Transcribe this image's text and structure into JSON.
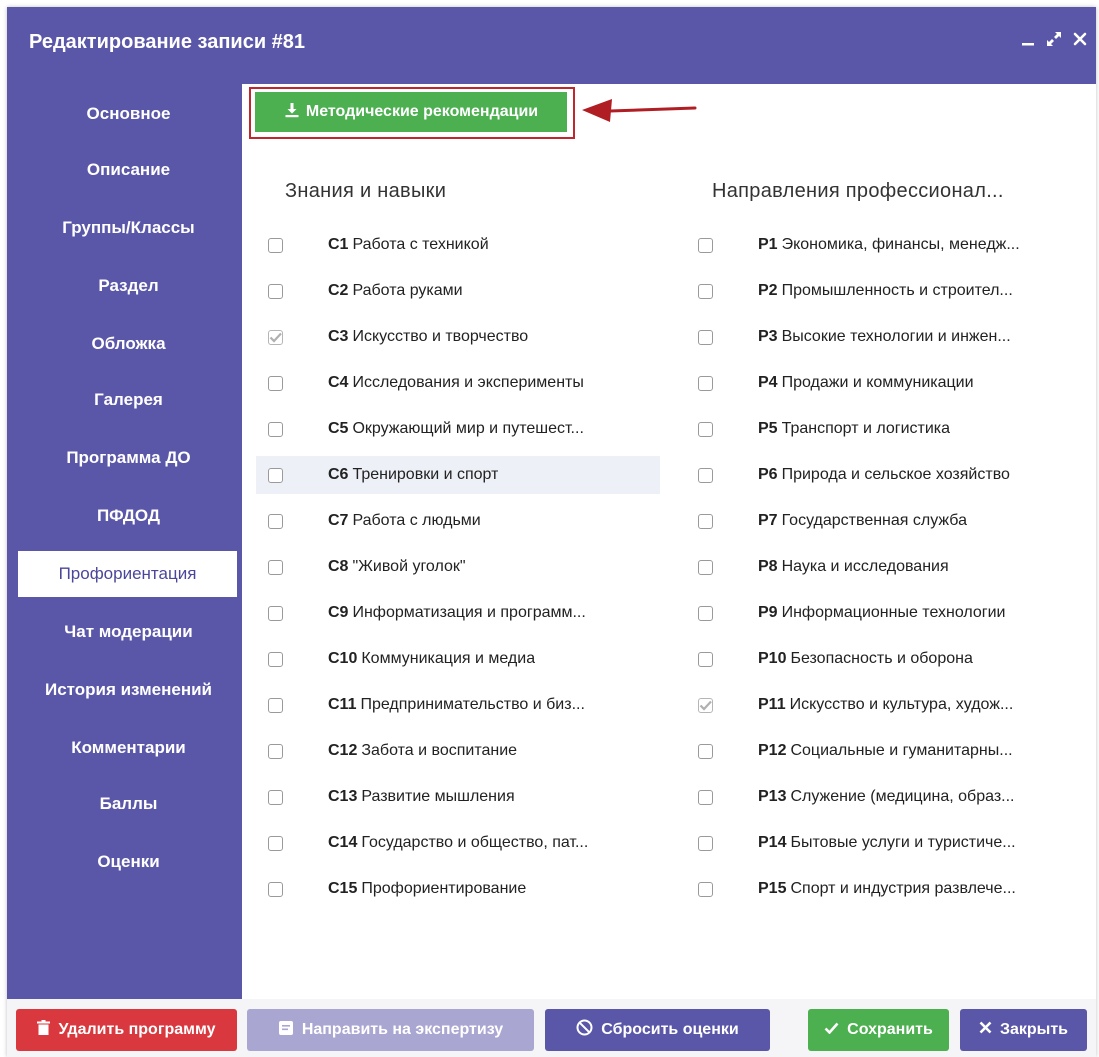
{
  "window": {
    "title": "Редактирование записи #81"
  },
  "sidebar": {
    "items": [
      {
        "label": "Основное"
      },
      {
        "label": "Описание"
      },
      {
        "label": "Группы/Классы"
      },
      {
        "label": "Раздел"
      },
      {
        "label": "Обложка"
      },
      {
        "label": "Галерея"
      },
      {
        "label": "Программа ДО"
      },
      {
        "label": "ПФДОД"
      },
      {
        "label": "Профориентация",
        "active": true
      },
      {
        "label": "Чат модерации"
      },
      {
        "label": "История изменений"
      },
      {
        "label": "Комментарии"
      },
      {
        "label": "Баллы"
      },
      {
        "label": "Оценки"
      }
    ]
  },
  "main": {
    "method_button": "Методические рекомендации",
    "skills": {
      "title": "Знания и навыки",
      "items": [
        {
          "code": "C1",
          "label": "Работа с техникой",
          "checked": false
        },
        {
          "code": "C2",
          "label": "Работа руками",
          "checked": false
        },
        {
          "code": "C3",
          "label": "Искусство и творчество",
          "checked": true
        },
        {
          "code": "C4",
          "label": "Исследования и эксперименты",
          "checked": false
        },
        {
          "code": "C5",
          "label": "Окружающий мир и путешест...",
          "checked": false
        },
        {
          "code": "C6",
          "label": "Тренировки и спорт",
          "checked": false
        },
        {
          "code": "C7",
          "label": "Работа с людьми",
          "checked": false
        },
        {
          "code": "C8",
          "label": "\"Живой уголок\"",
          "checked": false
        },
        {
          "code": "C9",
          "label": "Информатизация и программ...",
          "checked": false
        },
        {
          "code": "C10",
          "label": "Коммуникация и медиа",
          "checked": false
        },
        {
          "code": "C11",
          "label": "Предпринимательство и биз...",
          "checked": false
        },
        {
          "code": "C12",
          "label": "Забота и воспитание",
          "checked": false
        },
        {
          "code": "C13",
          "label": "Развитие мышления",
          "checked": false
        },
        {
          "code": "C14",
          "label": "Государство и общество, пат...",
          "checked": false
        },
        {
          "code": "C15",
          "label": "Профориентирование",
          "checked": false
        }
      ]
    },
    "directions": {
      "title": "Направления профессионал...",
      "items": [
        {
          "code": "P1",
          "label": "Экономика, финансы, менедж...",
          "checked": false
        },
        {
          "code": "P2",
          "label": "Промышленность и строител...",
          "checked": false
        },
        {
          "code": "P3",
          "label": "Высокие технологии и инжен...",
          "checked": false
        },
        {
          "code": "P4",
          "label": "Продажи и коммуникации",
          "checked": false
        },
        {
          "code": "P5",
          "label": "Транспорт и логистика",
          "checked": false
        },
        {
          "code": "P6",
          "label": "Природа и сельское хозяйство",
          "checked": false
        },
        {
          "code": "P7",
          "label": "Государственная служба",
          "checked": false
        },
        {
          "code": "P8",
          "label": "Наука и исследования",
          "checked": false
        },
        {
          "code": "P9",
          "label": "Информационные технологии",
          "checked": false
        },
        {
          "code": "P10",
          "label": "Безопасность и оборона",
          "checked": false
        },
        {
          "code": "P11",
          "label": "Искусство и культура, худож...",
          "checked": true
        },
        {
          "code": "P12",
          "label": "Социальные и гуманитарны...",
          "checked": false
        },
        {
          "code": "P13",
          "label": "Служение (медицина, образ...",
          "checked": false
        },
        {
          "code": "P14",
          "label": "Бытовые услуги и туристиче...",
          "checked": false
        },
        {
          "code": "P15",
          "label": "Спорт и индустрия развлече...",
          "checked": false
        }
      ]
    }
  },
  "footer": {
    "delete": "Удалить программу",
    "expertise": "Направить на экспертизу",
    "reset": "Сбросить оценки",
    "save": "Сохранить",
    "close": "Закрыть"
  },
  "colors": {
    "primary": "#5b57a8",
    "success": "#4caf50",
    "danger": "#d9393e",
    "disabled": "#a9a6d2",
    "highlight": "#c0272d"
  }
}
